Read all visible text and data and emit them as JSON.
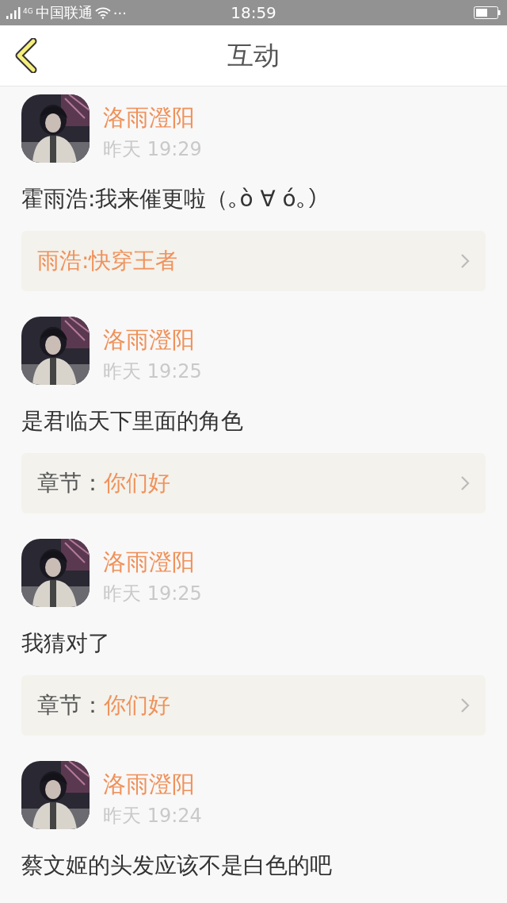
{
  "status_bar": {
    "network": "4G",
    "carrier": "中国联通",
    "dots": "···",
    "time": "18:59"
  },
  "header": {
    "title": "互动"
  },
  "items": [
    {
      "name": "洛雨澄阳",
      "time": "昨天 19:29",
      "comment": "霍雨浩:我来催更啦（｡ò ∀ ó｡）",
      "link": {
        "kind": "plain",
        "title": "雨浩:快穿王者"
      }
    },
    {
      "name": "洛雨澄阳",
      "time": "昨天 19:25",
      "comment": "是君临天下里面的角色",
      "link": {
        "kind": "chapter",
        "label": "章节：",
        "title": "你们好"
      }
    },
    {
      "name": "洛雨澄阳",
      "time": "昨天 19:25",
      "comment": "我猜对了",
      "link": {
        "kind": "chapter",
        "label": "章节：",
        "title": "你们好"
      }
    },
    {
      "name": "洛雨澄阳",
      "time": "昨天 19:24",
      "comment": "蔡文姬的头发应该不是白色的吧"
    }
  ]
}
